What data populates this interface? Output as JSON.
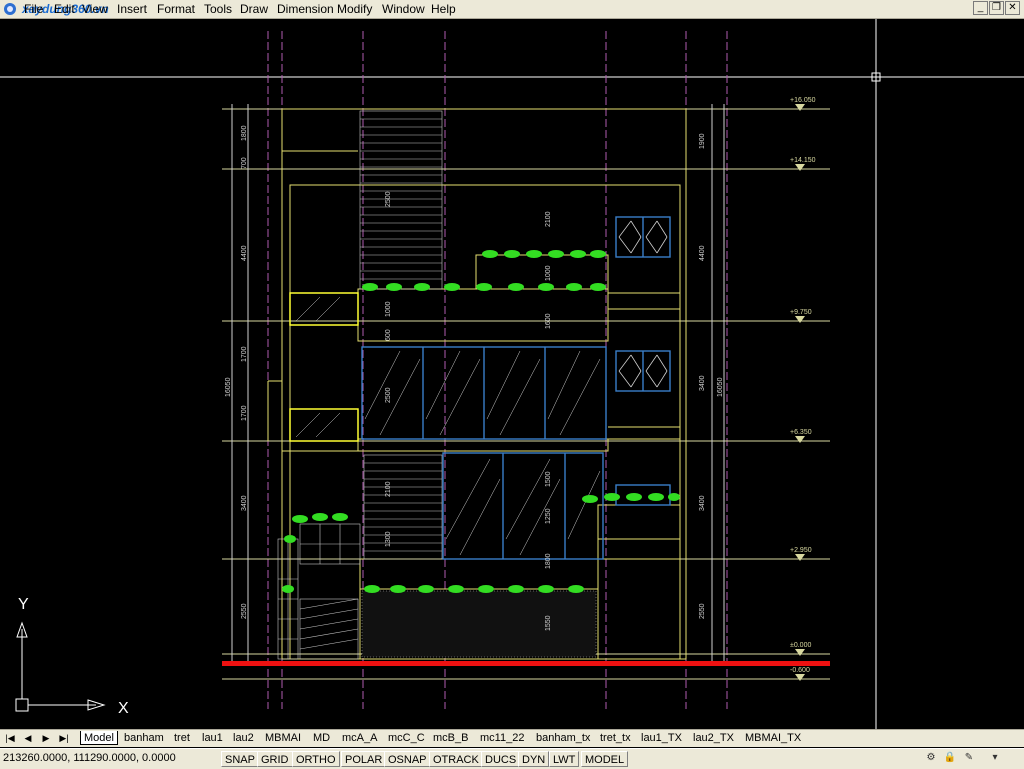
{
  "menubar": {
    "brand": "xaydung360.vn",
    "items": [
      "File",
      "Edit",
      "View",
      "Insert",
      "Format",
      "Tools",
      "Draw",
      "Dimension",
      "Modify",
      "Window",
      "Help"
    ]
  },
  "window_controls": {
    "minimize": "_",
    "restore": "❐",
    "close": "✕"
  },
  "drawing": {
    "levels": [
      "+16.050",
      "+14.150",
      "+9.750",
      "+6.350",
      "+2.950",
      "±0.000",
      "-0.600"
    ],
    "left_dims": [
      "1800",
      "700",
      "4400",
      "1700",
      "1700",
      "3400",
      "2550"
    ],
    "left_total": "16050",
    "right_dims": [
      "1900",
      "4400",
      "3400",
      "3400",
      "2550"
    ],
    "right_total": "16050",
    "center_dims": [
      "2500",
      "2100",
      "1000",
      "1600",
      "1000",
      "600",
      "2500",
      "2100",
      "1300",
      "1800",
      "1500",
      "1250",
      "1550"
    ],
    "ucs": {
      "x": "X",
      "y": "Y"
    }
  },
  "tabs": {
    "nav": [
      "|◀",
      "◀",
      "▶",
      "▶|"
    ],
    "items": [
      "Model",
      "banham",
      "tret",
      "lau1",
      "lau2",
      "MBMAI",
      "MD",
      "mcA_A",
      "mcC_C",
      "mcB_B",
      "mc11_22",
      "banham_tx",
      "tret_tx",
      "lau1_TX",
      "lau2_TX",
      "MBMAI_TX"
    ],
    "active": "Model"
  },
  "statusbar": {
    "coords": "213260.0000, 111290.0000, 0.0000",
    "buttons": [
      "SNAP",
      "GRID",
      "ORTHO",
      "POLAR",
      "OSNAP",
      "OTRACK",
      "DUCS",
      "DYN",
      "LWT",
      "MODEL"
    ]
  }
}
